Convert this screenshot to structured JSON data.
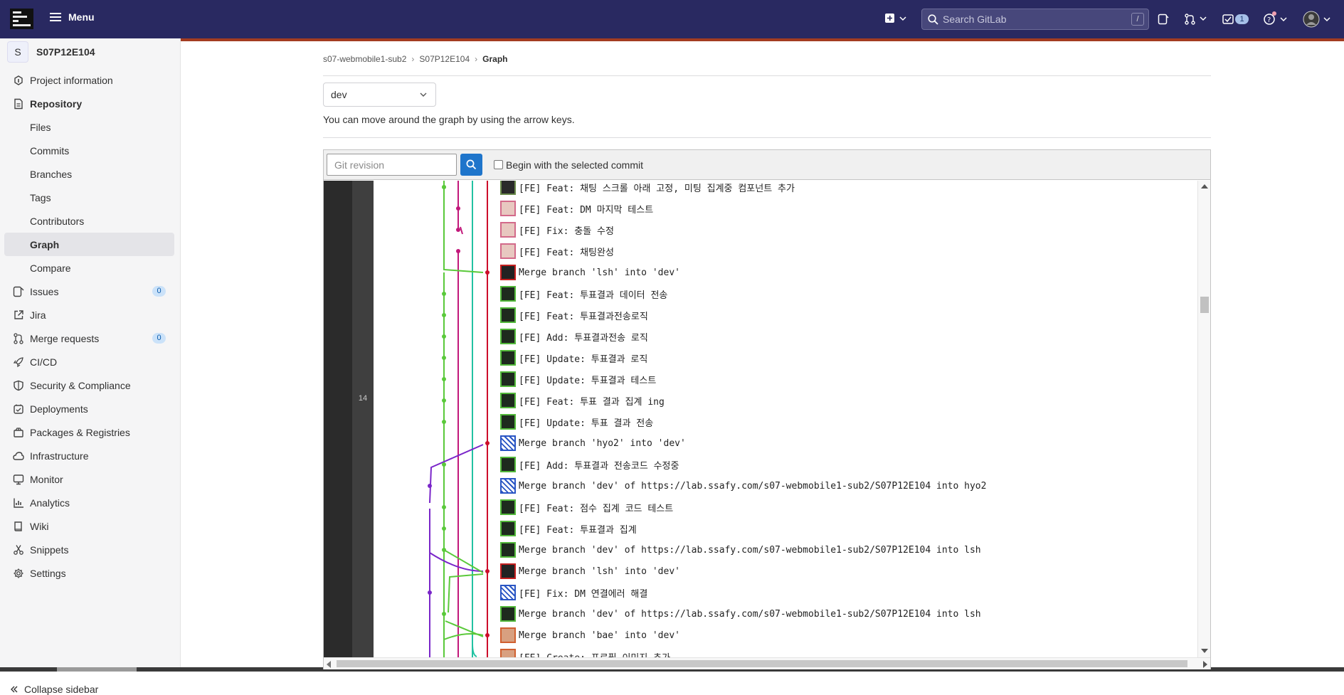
{
  "topbar": {
    "menu_label": "Menu",
    "search_placeholder": "Search GitLab",
    "search_shortcut": "/",
    "todo_count": "1"
  },
  "sidebar": {
    "project_initial": "S",
    "project_name": "S07P12E104",
    "items": [
      {
        "label": "Project information",
        "icon": "info-icon"
      },
      {
        "label": "Repository",
        "icon": "document-icon"
      },
      {
        "label": "Files"
      },
      {
        "label": "Commits"
      },
      {
        "label": "Branches"
      },
      {
        "label": "Tags"
      },
      {
        "label": "Contributors"
      },
      {
        "label": "Graph",
        "active": true
      },
      {
        "label": "Compare"
      },
      {
        "label": "Issues",
        "icon": "issues-icon",
        "badge": "0"
      },
      {
        "label": "Jira",
        "icon": "external-link-icon"
      },
      {
        "label": "Merge requests",
        "icon": "merge-request-icon",
        "badge": "0"
      },
      {
        "label": "CI/CD",
        "icon": "rocket-icon"
      },
      {
        "label": "Security & Compliance",
        "icon": "shield-icon"
      },
      {
        "label": "Deployments",
        "icon": "deployments-icon"
      },
      {
        "label": "Packages & Registries",
        "icon": "package-icon"
      },
      {
        "label": "Infrastructure",
        "icon": "cloud-icon"
      },
      {
        "label": "Monitor",
        "icon": "monitor-icon"
      },
      {
        "label": "Analytics",
        "icon": "chart-icon"
      },
      {
        "label": "Wiki",
        "icon": "book-icon"
      },
      {
        "label": "Snippets",
        "icon": "scissors-icon"
      },
      {
        "label": "Settings",
        "icon": "gear-icon"
      }
    ],
    "collapse_label": "Collapse sidebar"
  },
  "breadcrumb": [
    "s07-webmobile1-sub2",
    "S07P12E104",
    "Graph"
  ],
  "branch_select": "dev",
  "hint": "You can move around the graph by using the arrow keys.",
  "graph": {
    "revision_placeholder": "Git revision",
    "begin_label": "Begin with the selected commit",
    "day_label": "14",
    "commits": [
      {
        "msg": "[FE] Feat: 채팅 스크롤 아래 고정, 미팅 집계중 컴포넌트 추가",
        "avatar": "dark"
      },
      {
        "msg": "[FE] Feat: DM 마지막 테스트",
        "avatar": "pink"
      },
      {
        "msg": "[FE] Fix: 충돌 수정",
        "avatar": "pink"
      },
      {
        "msg": "[FE] Feat: 채팅완성",
        "avatar": "pink"
      },
      {
        "msg": "Merge branch 'lsh' into 'dev'",
        "avatar": "red"
      },
      {
        "msg": "[FE] Feat: 투표결과 데이터 전송",
        "avatar": "green"
      },
      {
        "msg": "[FE] Feat: 투표결과전송로직",
        "avatar": "green"
      },
      {
        "msg": "[FE] Add: 투표결과전송 로직",
        "avatar": "green"
      },
      {
        "msg": "[FE] Update: 투표결과 로직",
        "avatar": "green"
      },
      {
        "msg": "[FE] Update: 투표결과 테스트",
        "avatar": "green"
      },
      {
        "msg": "[FE] Feat: 투표 결과 집계 ing",
        "avatar": "green"
      },
      {
        "msg": "[FE] Update: 투표 결과 전송",
        "avatar": "green"
      },
      {
        "msg": "Merge branch 'hyo2' into 'dev'",
        "avatar": "pattern"
      },
      {
        "msg": "[FE] Add: 투표결과 전송코드 수정중",
        "avatar": "green"
      },
      {
        "msg": "Merge branch 'dev' of https://lab.ssafy.com/s07-webmobile1-sub2/S07P12E104 into hyo2",
        "avatar": "pattern"
      },
      {
        "msg": "[FE] Feat: 점수 집계 코드 테스트",
        "avatar": "green"
      },
      {
        "msg": "[FE] Feat: 투표결과 집계",
        "avatar": "green"
      },
      {
        "msg": "Merge branch 'dev' of https://lab.ssafy.com/s07-webmobile1-sub2/S07P12E104 into lsh",
        "avatar": "green"
      },
      {
        "msg": "Merge branch 'lsh' into 'dev'",
        "avatar": "red"
      },
      {
        "msg": "[FE] Fix: DM 연결에러 해결",
        "avatar": "pattern"
      },
      {
        "msg": "Merge branch 'dev' of https://lab.ssafy.com/s07-webmobile1-sub2/S07P12E104 into lsh",
        "avatar": "green"
      },
      {
        "msg": "Merge branch 'bae' into 'dev'",
        "avatar": "orange"
      },
      {
        "msg": "[FE] Create: 프로필 이미지 추가",
        "avatar": "orange"
      }
    ],
    "colors": {
      "green": "#5ac93a",
      "magenta": "#c2187a",
      "teal": "#22c2a2",
      "red": "#cc0d2a",
      "purple": "#7a26c9"
    }
  }
}
